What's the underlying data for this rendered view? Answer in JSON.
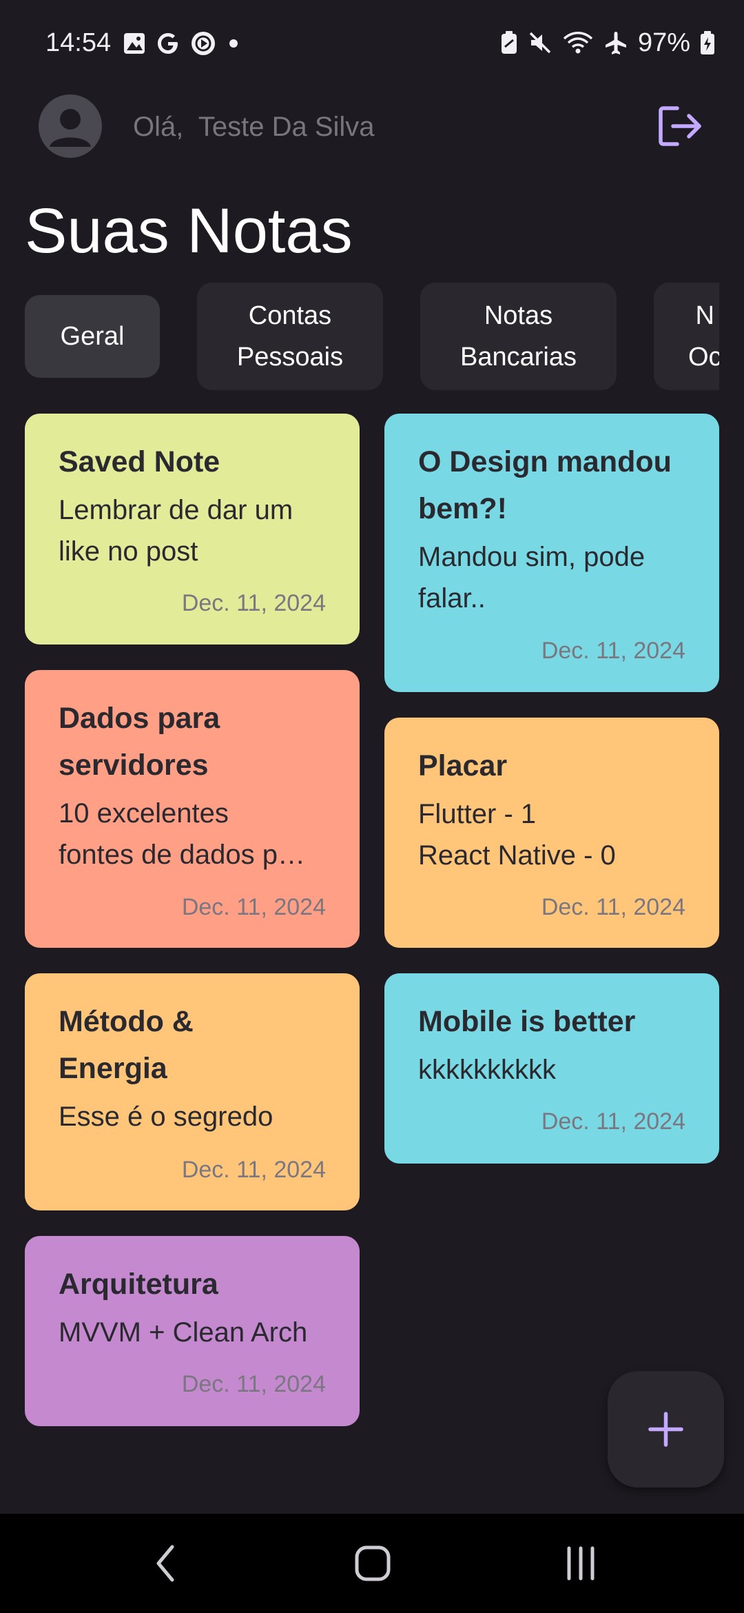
{
  "status_bar": {
    "time": "14:54",
    "battery": "97%",
    "icons_left": [
      "gallery-icon",
      "google-icon",
      "media-icon",
      "dot-icon"
    ],
    "icons_right": [
      "battery-saver-icon",
      "mute-icon",
      "wifi-icon",
      "airplane-icon",
      "battery-charging-icon"
    ]
  },
  "header": {
    "greeting": "Olá,  Teste Da Silva",
    "avatar_icon": "person-icon",
    "logout_icon": "logout-icon"
  },
  "page_title": "Suas Notas",
  "tabs": [
    {
      "label": "Geral",
      "active": true
    },
    {
      "label": "Contas\nPessoais",
      "active": false
    },
    {
      "label": "Notas\nBancarias",
      "active": false
    },
    {
      "label": "N\nOc",
      "active": false
    }
  ],
  "notes": [
    {
      "title": "Saved Note",
      "body": "Lembrar de dar um like no post",
      "date": "Dec. 11, 2024",
      "color": "#e2eb98"
    },
    {
      "title": "O Design mandou bem?!",
      "body": "Mandou sim, pode falar..",
      "date": "Dec. 11, 2024",
      "color": "#78d9e5"
    },
    {
      "title": "Dados para servidores",
      "body": "10 excelentes fontes de dados p…",
      "date": "Dec. 11, 2024",
      "color": "#ff9f85"
    },
    {
      "title": "Placar",
      "body": "Flutter - 1\nReact Native - 0",
      "date": "Dec. 11, 2024",
      "color": "#ffc679"
    },
    {
      "title": "Método & Energia",
      "body": "Esse é o segredo",
      "date": "Dec. 11, 2024",
      "color": "#ffc679"
    },
    {
      "title": "Mobile is better",
      "body": "kkkkkkkkkk",
      "date": "Dec. 11, 2024",
      "color": "#78d9e5"
    },
    {
      "title": "Arquitetura",
      "body": "MVVM + Clean Arch",
      "date": "Dec. 11, 2024",
      "color": "#c589d0"
    }
  ],
  "fab": {
    "icon": "plus-icon"
  },
  "nav_bar": {
    "icons": [
      "back-icon",
      "home-icon",
      "recents-icon"
    ]
  },
  "colors": {
    "background": "#1d1b21",
    "accent": "#c3a9ff",
    "tab_bg": "#2a282e",
    "tab_active_bg": "#3a383f"
  }
}
